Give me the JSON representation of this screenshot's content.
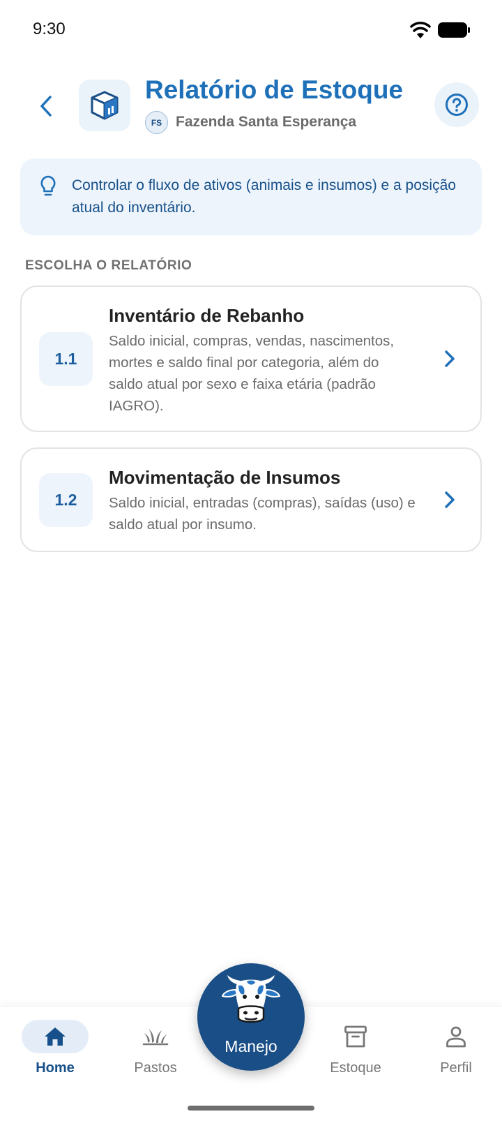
{
  "status_bar": {
    "time": "9:30"
  },
  "header": {
    "title": "Relatório de Estoque",
    "farm_initials": "FS",
    "farm_name": "Fazenda Santa Esperança"
  },
  "info_banner": {
    "text": "Controlar o fluxo de ativos (animais e insumos) e a posição atual do inventário."
  },
  "section_label": "ESCOLHA O RELATÓRIO",
  "reports": [
    {
      "number": "1.1",
      "title": "Inventário de Rebanho",
      "description": "Saldo inicial, compras, vendas, nascimentos, mortes e saldo final por categoria, além do saldo atual por sexo e faixa etária (padrão IAGRO)."
    },
    {
      "number": "1.2",
      "title": "Movimentação de Insumos",
      "description": "Saldo inicial, entradas (compras), saídas (uso) e saldo atual por insumo."
    }
  ],
  "bottom_nav": {
    "items": [
      {
        "label": "Home",
        "icon": "home-icon",
        "active": true
      },
      {
        "label": "Pastos",
        "icon": "grass-icon",
        "active": false
      },
      {
        "label": "Estoque",
        "icon": "archive-icon",
        "active": false
      },
      {
        "label": "Perfil",
        "icon": "person-icon",
        "active": false
      }
    ],
    "fab_label": "Manejo",
    "fab_icon": "cow-icon"
  },
  "colors": {
    "primary": "#1e70b8",
    "primary_dark": "#1a4e87",
    "banner_bg": "#edf4fb",
    "muted_text": "#6b6b6b"
  }
}
